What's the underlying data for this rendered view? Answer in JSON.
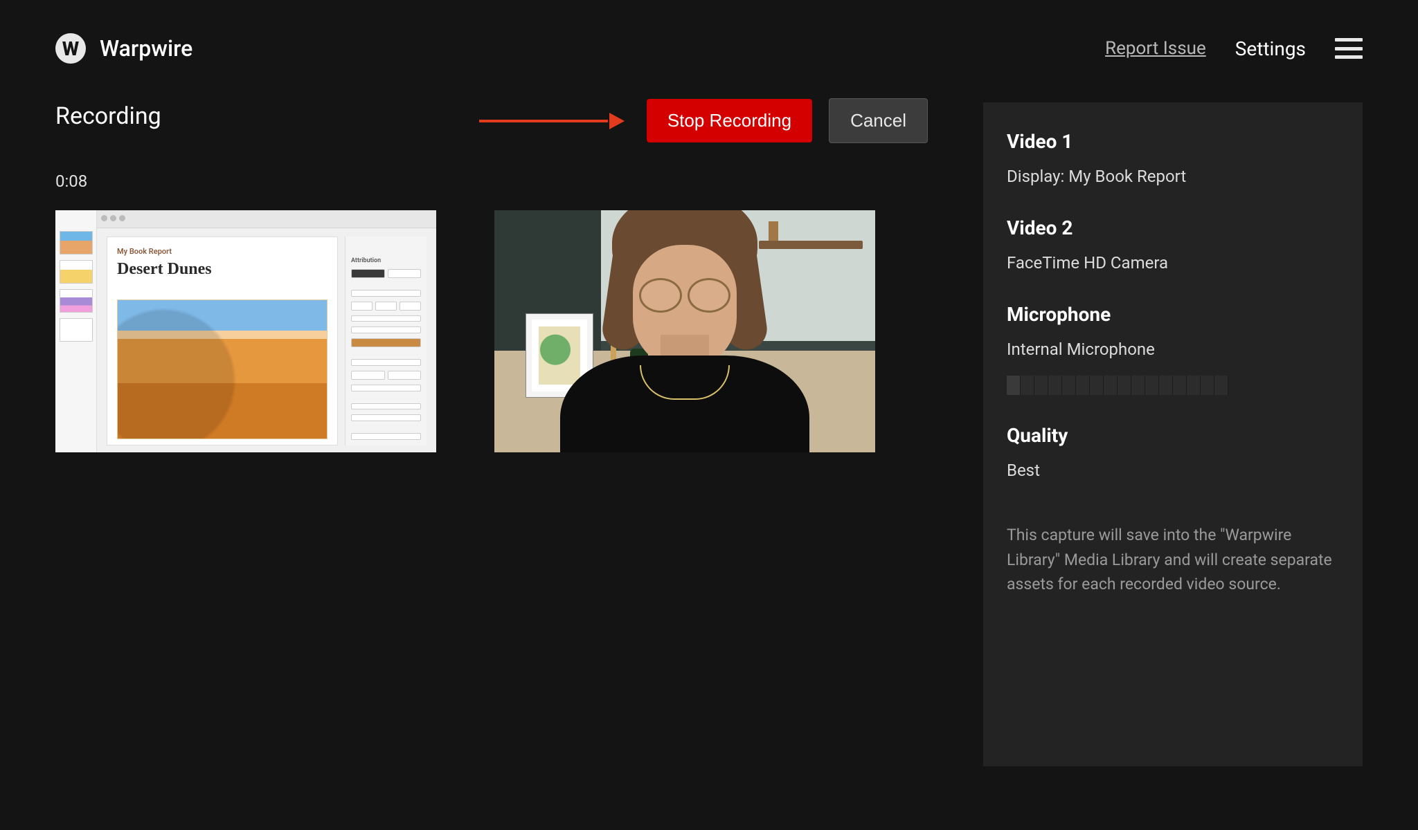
{
  "brand": {
    "name": "Warpwire",
    "glyph": "W"
  },
  "header": {
    "report_link": "Report Issue",
    "settings": "Settings"
  },
  "page": {
    "title": "Recording",
    "timer": "0:08"
  },
  "actions": {
    "stop": "Stop Recording",
    "cancel": "Cancel"
  },
  "preview1": {
    "doc_label": "My Book Report",
    "slide_title": "Desert Dunes",
    "inspector_label": "Attribution"
  },
  "sidebar": {
    "video1_heading": "Video 1",
    "video1_value": "Display: My Book Report",
    "video2_heading": "Video 2",
    "video2_value": "FaceTime HD Camera",
    "mic_heading": "Microphone",
    "mic_value": "Internal Microphone",
    "mic_level_segments": 16,
    "mic_level_active": 1,
    "quality_heading": "Quality",
    "quality_value": "Best",
    "note": "This capture will save into the \"Warpwire Library\" Media Library and will create separate assets for each recorded video source."
  }
}
